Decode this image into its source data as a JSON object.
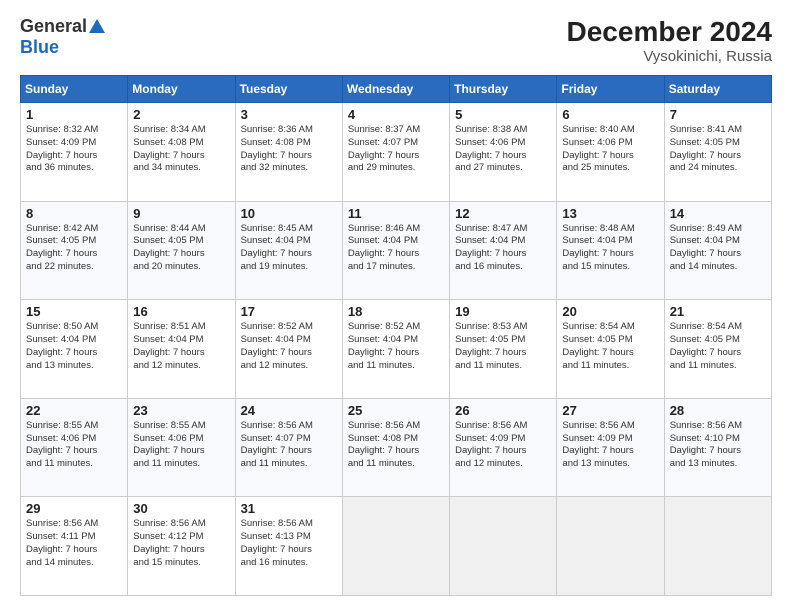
{
  "logo": {
    "general": "General",
    "blue": "Blue"
  },
  "title": "December 2024",
  "subtitle": "Vysokinichi, Russia",
  "days_header": [
    "Sunday",
    "Monday",
    "Tuesday",
    "Wednesday",
    "Thursday",
    "Friday",
    "Saturday"
  ],
  "weeks": [
    [
      {
        "day": "1",
        "info": "Sunrise: 8:32 AM\nSunset: 4:09 PM\nDaylight: 7 hours\nand 36 minutes."
      },
      {
        "day": "2",
        "info": "Sunrise: 8:34 AM\nSunset: 4:08 PM\nDaylight: 7 hours\nand 34 minutes."
      },
      {
        "day": "3",
        "info": "Sunrise: 8:36 AM\nSunset: 4:08 PM\nDaylight: 7 hours\nand 32 minutes."
      },
      {
        "day": "4",
        "info": "Sunrise: 8:37 AM\nSunset: 4:07 PM\nDaylight: 7 hours\nand 29 minutes."
      },
      {
        "day": "5",
        "info": "Sunrise: 8:38 AM\nSunset: 4:06 PM\nDaylight: 7 hours\nand 27 minutes."
      },
      {
        "day": "6",
        "info": "Sunrise: 8:40 AM\nSunset: 4:06 PM\nDaylight: 7 hours\nand 25 minutes."
      },
      {
        "day": "7",
        "info": "Sunrise: 8:41 AM\nSunset: 4:05 PM\nDaylight: 7 hours\nand 24 minutes."
      }
    ],
    [
      {
        "day": "8",
        "info": "Sunrise: 8:42 AM\nSunset: 4:05 PM\nDaylight: 7 hours\nand 22 minutes."
      },
      {
        "day": "9",
        "info": "Sunrise: 8:44 AM\nSunset: 4:05 PM\nDaylight: 7 hours\nand 20 minutes."
      },
      {
        "day": "10",
        "info": "Sunrise: 8:45 AM\nSunset: 4:04 PM\nDaylight: 7 hours\nand 19 minutes."
      },
      {
        "day": "11",
        "info": "Sunrise: 8:46 AM\nSunset: 4:04 PM\nDaylight: 7 hours\nand 17 minutes."
      },
      {
        "day": "12",
        "info": "Sunrise: 8:47 AM\nSunset: 4:04 PM\nDaylight: 7 hours\nand 16 minutes."
      },
      {
        "day": "13",
        "info": "Sunrise: 8:48 AM\nSunset: 4:04 PM\nDaylight: 7 hours\nand 15 minutes."
      },
      {
        "day": "14",
        "info": "Sunrise: 8:49 AM\nSunset: 4:04 PM\nDaylight: 7 hours\nand 14 minutes."
      }
    ],
    [
      {
        "day": "15",
        "info": "Sunrise: 8:50 AM\nSunset: 4:04 PM\nDaylight: 7 hours\nand 13 minutes."
      },
      {
        "day": "16",
        "info": "Sunrise: 8:51 AM\nSunset: 4:04 PM\nDaylight: 7 hours\nand 12 minutes."
      },
      {
        "day": "17",
        "info": "Sunrise: 8:52 AM\nSunset: 4:04 PM\nDaylight: 7 hours\nand 12 minutes."
      },
      {
        "day": "18",
        "info": "Sunrise: 8:52 AM\nSunset: 4:04 PM\nDaylight: 7 hours\nand 11 minutes."
      },
      {
        "day": "19",
        "info": "Sunrise: 8:53 AM\nSunset: 4:05 PM\nDaylight: 7 hours\nand 11 minutes."
      },
      {
        "day": "20",
        "info": "Sunrise: 8:54 AM\nSunset: 4:05 PM\nDaylight: 7 hours\nand 11 minutes."
      },
      {
        "day": "21",
        "info": "Sunrise: 8:54 AM\nSunset: 4:05 PM\nDaylight: 7 hours\nand 11 minutes."
      }
    ],
    [
      {
        "day": "22",
        "info": "Sunrise: 8:55 AM\nSunset: 4:06 PM\nDaylight: 7 hours\nand 11 minutes."
      },
      {
        "day": "23",
        "info": "Sunrise: 8:55 AM\nSunset: 4:06 PM\nDaylight: 7 hours\nand 11 minutes."
      },
      {
        "day": "24",
        "info": "Sunrise: 8:56 AM\nSunset: 4:07 PM\nDaylight: 7 hours\nand 11 minutes."
      },
      {
        "day": "25",
        "info": "Sunrise: 8:56 AM\nSunset: 4:08 PM\nDaylight: 7 hours\nand 11 minutes."
      },
      {
        "day": "26",
        "info": "Sunrise: 8:56 AM\nSunset: 4:09 PM\nDaylight: 7 hours\nand 12 minutes."
      },
      {
        "day": "27",
        "info": "Sunrise: 8:56 AM\nSunset: 4:09 PM\nDaylight: 7 hours\nand 13 minutes."
      },
      {
        "day": "28",
        "info": "Sunrise: 8:56 AM\nSunset: 4:10 PM\nDaylight: 7 hours\nand 13 minutes."
      }
    ],
    [
      {
        "day": "29",
        "info": "Sunrise: 8:56 AM\nSunset: 4:11 PM\nDaylight: 7 hours\nand 14 minutes."
      },
      {
        "day": "30",
        "info": "Sunrise: 8:56 AM\nSunset: 4:12 PM\nDaylight: 7 hours\nand 15 minutes."
      },
      {
        "day": "31",
        "info": "Sunrise: 8:56 AM\nSunset: 4:13 PM\nDaylight: 7 hours\nand 16 minutes."
      },
      null,
      null,
      null,
      null
    ]
  ]
}
